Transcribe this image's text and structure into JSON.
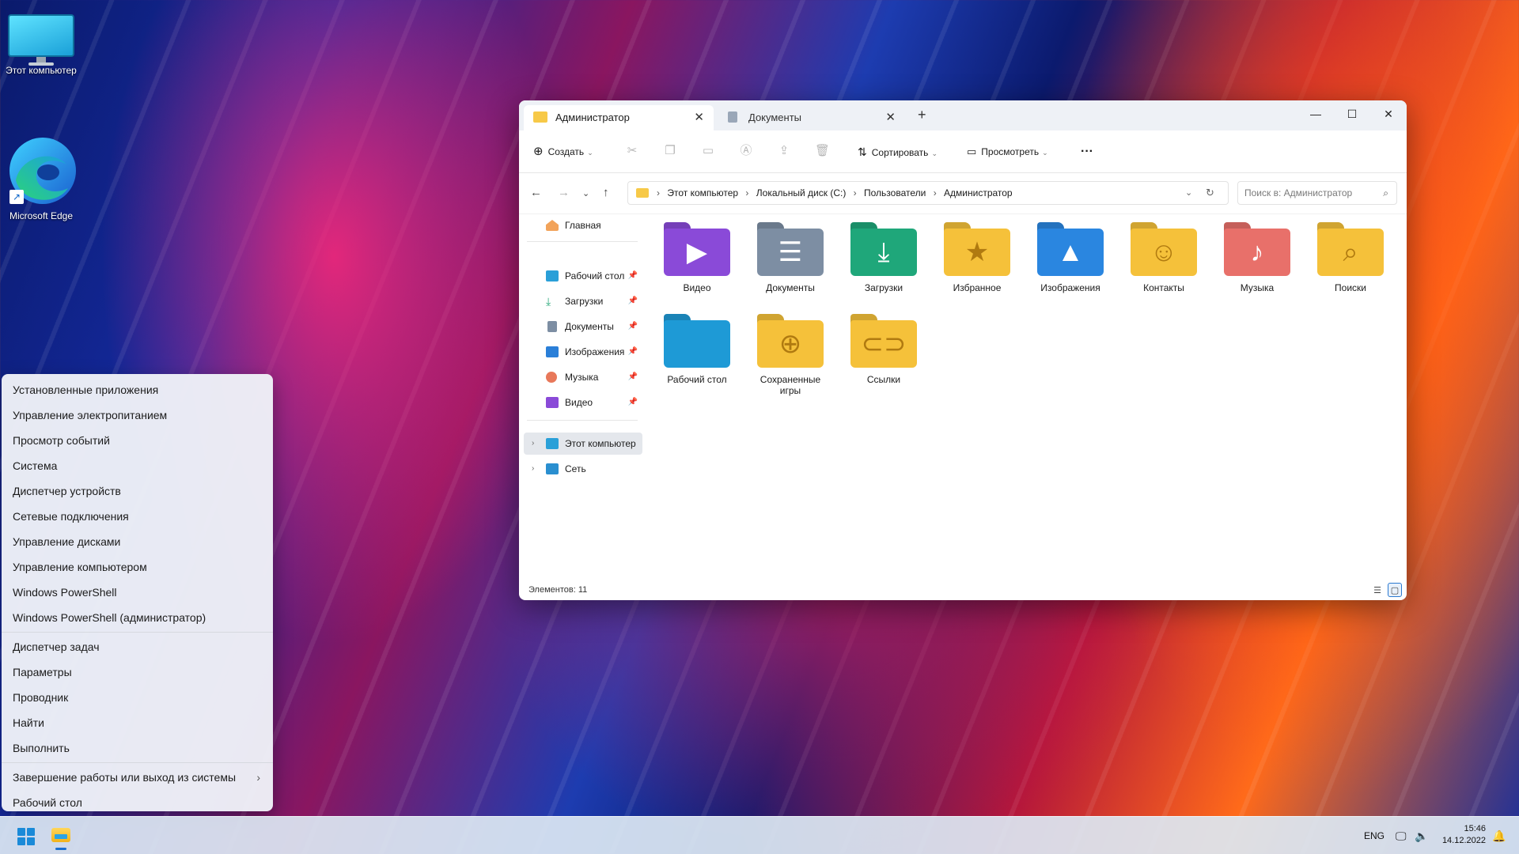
{
  "desktop": {
    "icons": [
      {
        "label": "Этот компьютер",
        "icon": "this-pc-icon"
      },
      {
        "label": "Microsoft Edge",
        "icon": "edge-icon"
      }
    ]
  },
  "context_menu": {
    "group1": [
      "Установленные приложения",
      "Управление электропитанием",
      "Просмотр событий",
      "Система",
      "Диспетчер устройств",
      "Сетевые подключения",
      "Управление дисками",
      "Управление компьютером",
      "Windows PowerShell",
      "Windows PowerShell (администратор)"
    ],
    "group2": [
      "Диспетчер задач",
      "Параметры",
      "Проводник",
      "Найти",
      "Выполнить"
    ],
    "group3": [
      "Завершение работы или выход из системы",
      "Рабочий стол"
    ],
    "submenu_arrow": "›"
  },
  "explorer": {
    "tabs": [
      {
        "label": "Администратор",
        "active": true
      },
      {
        "label": "Документы",
        "active": false
      }
    ],
    "tab_close": "✕",
    "new_tab": "+",
    "window_controls": {
      "minimize": "—",
      "maximize": "☐",
      "close": "✕"
    },
    "toolbar": {
      "create_label": "Создать",
      "sort_label": "Сортировать",
      "view_label": "Просмотреть",
      "more_label": "···",
      "icons": [
        "cut-icon",
        "copy-icon",
        "paste-icon",
        "rename-icon",
        "share-icon",
        "delete-icon"
      ]
    },
    "address": {
      "crumbs": [
        "Этот компьютер",
        "Локальный диск (C:)",
        "Пользователи",
        "Администратор"
      ],
      "separator": "›"
    },
    "search_placeholder": "Поиск в: Администратор",
    "nav": {
      "home": "Главная",
      "pinned": [
        {
          "label": "Рабочий стол",
          "color": "#2a9fd8"
        },
        {
          "label": "Загрузки",
          "color": "#2aa87a"
        },
        {
          "label": "Документы",
          "color": "#7d8ea3"
        },
        {
          "label": "Изображения",
          "color": "#2a7fd8"
        },
        {
          "label": "Музыка",
          "color": "#e8785a"
        },
        {
          "label": "Видео",
          "color": "#8a4ad8"
        }
      ],
      "this_pc": "Этот компьютер",
      "network": "Сеть"
    },
    "items": [
      {
        "label": "Видео",
        "color": "#8a4ad8",
        "glyph": "▶"
      },
      {
        "label": "Документы",
        "color": "#7d8ea3",
        "glyph": "☰"
      },
      {
        "label": "Загрузки",
        "color": "#1fa77a",
        "glyph": "⤓"
      },
      {
        "label": "Избранное",
        "color": "#f5c13a",
        "glyph": "★"
      },
      {
        "label": "Изображения",
        "color": "#2a86e0",
        "glyph": "▲"
      },
      {
        "label": "Контакты",
        "color": "#f5c13a",
        "glyph": "☺"
      },
      {
        "label": "Музыка",
        "color": "#e8706a",
        "glyph": "♪"
      },
      {
        "label": "Поиски",
        "color": "#f5c13a",
        "glyph": "⌕"
      },
      {
        "label": "Рабочий стол",
        "color": "#1e9ad6",
        "glyph": ""
      },
      {
        "label": "Сохраненные игры",
        "color": "#f5c13a",
        "glyph": "⊕"
      },
      {
        "label": "Ссылки",
        "color": "#f5c13a",
        "glyph": "⊂⊃"
      }
    ],
    "status": "Элементов: 11"
  },
  "taskbar": {
    "lang": "ENG",
    "time": "15:46",
    "date": "14.12.2022"
  }
}
